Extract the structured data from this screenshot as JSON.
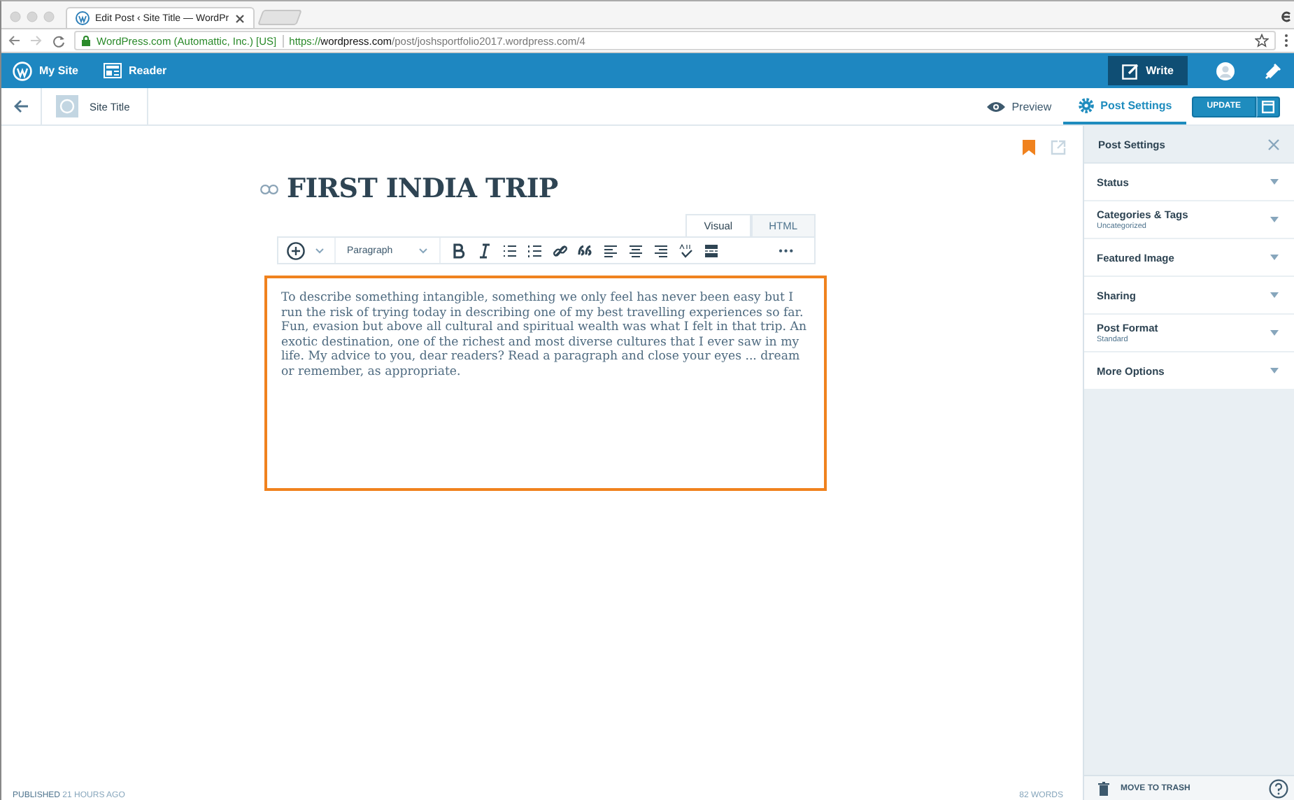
{
  "browser": {
    "tab_title": "Edit Post ‹ Site Title — WordPr",
    "secure_label": "WordPress.com (Automattic, Inc.) [US]",
    "url_scheme": "https://",
    "url_rest": "**wordpress.com**/post/joshsportfolio2017.wordpress.com/4"
  },
  "masterbar": {
    "my_site": "My Site",
    "reader": "Reader",
    "write": "Write"
  },
  "editor_bar": {
    "site_title": "Site Title",
    "preview": "Preview",
    "post_settings": {
      "label": "Post Settings",
      "selected": true
    },
    "update": "UPDATE"
  },
  "post": {
    "title": "FIRST INDIA TRIP",
    "editor_tabs": [
      {
        "label": "Visual",
        "selected": true
      },
      {
        "label": "HTML",
        "selected": false
      }
    ],
    "format": "Paragraph",
    "more": "•••",
    "body": "To describe something intangible, something we only feel has never been easy but I run the risk of trying today in describing one of my best travelling experiences so far. Fun, evasion but above all cultural and spiritual wealth was what I felt in that trip. An exotic destination, one of the richest and most diverse cultures that I ever saw in my life. My advice to you, dear readers? Read a paragraph and close your eyes ... dream or remember, as appropriate."
  },
  "sidebar": {
    "title": "Post Settings",
    "sections": [
      {
        "title": "Status"
      },
      {
        "title": "Categories & Tags",
        "subtitle": "Uncategorized"
      },
      {
        "title": "Featured Image"
      },
      {
        "title": "Sharing"
      },
      {
        "title": "Post Format",
        "subtitle": "Standard"
      },
      {
        "title": "More Options"
      }
    ],
    "trash": "MOVE TO TRASH"
  },
  "status_bar": {
    "state": "PUBLISHED",
    "time": "21 HOURS AGO",
    "words": "82 WORDS"
  }
}
